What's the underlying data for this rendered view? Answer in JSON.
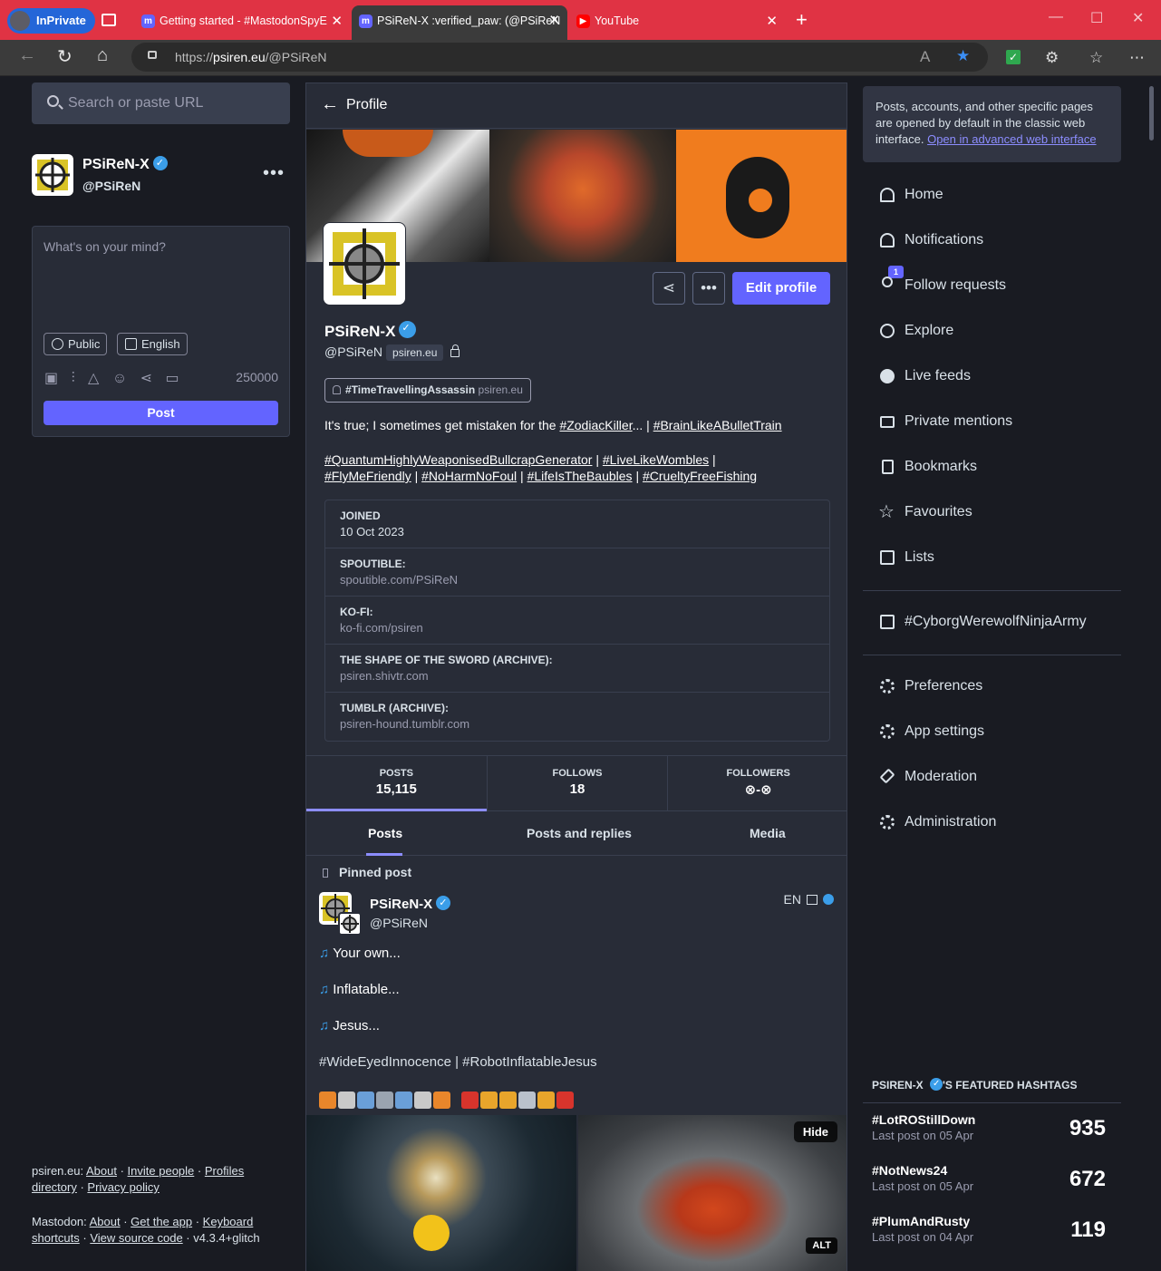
{
  "browser": {
    "inprivate_label": "InPrivate",
    "tabs": [
      {
        "title": "Getting started - #MastodonSpyE",
        "favicon": "mastodon-icon"
      },
      {
        "title": "PSiReN-X :verified_paw: (@PSiReN",
        "favicon": "mastodon-icon"
      },
      {
        "title": "YouTube",
        "favicon": "youtube-icon"
      }
    ],
    "url_prefix": "https://",
    "url_domain": "psiren.eu",
    "url_path": "/@PSiReN",
    "accent_color": "#e03344"
  },
  "left": {
    "search_placeholder": "Search or paste URL",
    "account_name": "PSiReN-X",
    "account_handle": "@PSiReN",
    "compose_placeholder": "What's on your mind?",
    "visibility": "Public",
    "language": "English",
    "char_count": "250000",
    "post_label": "Post",
    "footer1": {
      "prefix": "psiren.eu:",
      "links": [
        "About",
        "Invite people",
        "Profiles directory",
        "Privacy policy"
      ]
    },
    "footer2": {
      "prefix": "Mastodon:",
      "links": [
        "About",
        "Get the app",
        "Keyboard shortcuts",
        "View source code"
      ],
      "version": "v4.3.4+glitch"
    }
  },
  "profile": {
    "header_label": "Profile",
    "display_name": "PSiReN-X",
    "handle": "@PSiReN",
    "domain_badge": "psiren.eu",
    "edit_label": "Edit profile",
    "featured_tag": "#TimeTravellingAssassin",
    "featured_tag_domain": "psiren.eu",
    "bio_line1_text": "It's true; I sometimes get mistaken for the ",
    "bio_tag1": "#ZodiacKiller",
    "bio_sep1": "... | ",
    "bio_tag2": "#BrainLikeABulletTrain",
    "bio_tags2": [
      "#QuantumHighlyWeaponisedBullcrapGenerator",
      "#LiveLikeWombles"
    ],
    "bio_tags3": [
      "#FlyMeFriendly",
      "#NoHarmNoFoul",
      "#LifeIsTheBaubles",
      "#CrueltyFreeFishing"
    ],
    "fields": [
      {
        "key": "JOINED",
        "value": "10 Oct 2023"
      },
      {
        "key": "SPOUTIBLE:",
        "value": "spoutible.com/PSiReN"
      },
      {
        "key": "KO-FI:",
        "value": "ko-fi.com/psiren"
      },
      {
        "key": "THE SHAPE OF THE SWORD (ARCHIVE):",
        "value": "psiren.shivtr.com"
      },
      {
        "key": "TUMBLR (ARCHIVE):",
        "value": "psiren-hound.tumblr.com"
      }
    ],
    "stats": [
      {
        "label": "POSTS",
        "value": "15,115"
      },
      {
        "label": "FOLLOWS",
        "value": "18"
      },
      {
        "label": "FOLLOWERS",
        "value": "⊗-⊗"
      }
    ],
    "tabs": [
      "Posts",
      "Posts and replies",
      "Media"
    ]
  },
  "post": {
    "pinned_label": "Pinned post",
    "name": "PSiReN-X",
    "handle": "@PSiReN",
    "lang": "EN",
    "lines": [
      "Your own...",
      "Inflatable...",
      "Jesus..."
    ],
    "hashtags": "#WideEyedInnocence | #RobotInflatableJesus",
    "hide_label": "Hide",
    "alt_label": "ALT"
  },
  "right": {
    "notice_text": "Posts, accounts, and other specific pages are opened by default in the classic web interface. ",
    "notice_link": "Open in advanced web interface",
    "nav": [
      {
        "label": "Home",
        "icon": "home-icon"
      },
      {
        "label": "Notifications",
        "icon": "bell-icon"
      },
      {
        "label": "Follow requests",
        "icon": "person-add-icon"
      },
      {
        "label": "Explore",
        "icon": "compass-icon"
      },
      {
        "label": "Live feeds",
        "icon": "globe-icon"
      },
      {
        "label": "Private mentions",
        "icon": "envelope-icon"
      },
      {
        "label": "Bookmarks",
        "icon": "bookmark-icon"
      },
      {
        "label": "Favourites",
        "icon": "star-icon"
      },
      {
        "label": "Lists",
        "icon": "list-icon"
      }
    ],
    "follow_requests_badge": "1",
    "list_item": "#CyborgWerewolfNinjaArmy",
    "settings": [
      {
        "label": "Preferences",
        "icon": "gear-icon"
      },
      {
        "label": "App settings",
        "icon": "gears-icon"
      },
      {
        "label": "Moderation",
        "icon": "gavel-icon"
      },
      {
        "label": "Administration",
        "icon": "gears-icon"
      }
    ],
    "featured_title_prefix": "PSIREN-X",
    "featured_title_suffix": "'S FEATURED HASHTAGS",
    "featured": [
      {
        "tag": "#LotROStillDown",
        "last": "Last post on 05 Apr",
        "count": "935"
      },
      {
        "tag": "#NotNews24",
        "last": "Last post on 05 Apr",
        "count": "672"
      },
      {
        "tag": "#PlumAndRusty",
        "last": "Last post on 04 Apr",
        "count": "119"
      }
    ]
  }
}
